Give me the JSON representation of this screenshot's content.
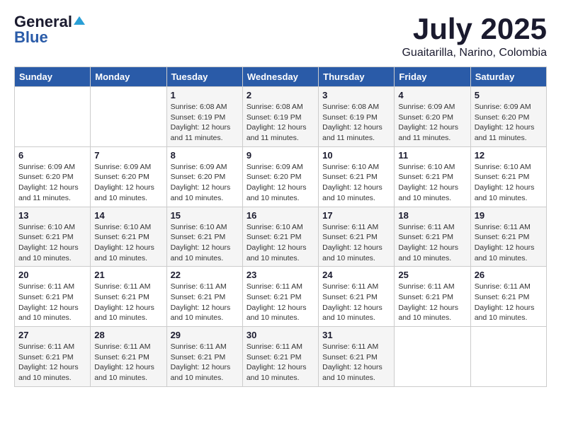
{
  "header": {
    "logo_general": "General",
    "logo_blue": "Blue",
    "month_title": "July 2025",
    "subtitle": "Guaitarilla, Narino, Colombia"
  },
  "calendar": {
    "days_of_week": [
      "Sunday",
      "Monday",
      "Tuesday",
      "Wednesday",
      "Thursday",
      "Friday",
      "Saturday"
    ],
    "weeks": [
      [
        {
          "day": "",
          "info": ""
        },
        {
          "day": "",
          "info": ""
        },
        {
          "day": "1",
          "info": "Sunrise: 6:08 AM\nSunset: 6:19 PM\nDaylight: 12 hours and 11 minutes."
        },
        {
          "day": "2",
          "info": "Sunrise: 6:08 AM\nSunset: 6:19 PM\nDaylight: 12 hours and 11 minutes."
        },
        {
          "day": "3",
          "info": "Sunrise: 6:08 AM\nSunset: 6:19 PM\nDaylight: 12 hours and 11 minutes."
        },
        {
          "day": "4",
          "info": "Sunrise: 6:09 AM\nSunset: 6:20 PM\nDaylight: 12 hours and 11 minutes."
        },
        {
          "day": "5",
          "info": "Sunrise: 6:09 AM\nSunset: 6:20 PM\nDaylight: 12 hours and 11 minutes."
        }
      ],
      [
        {
          "day": "6",
          "info": "Sunrise: 6:09 AM\nSunset: 6:20 PM\nDaylight: 12 hours and 11 minutes."
        },
        {
          "day": "7",
          "info": "Sunrise: 6:09 AM\nSunset: 6:20 PM\nDaylight: 12 hours and 10 minutes."
        },
        {
          "day": "8",
          "info": "Sunrise: 6:09 AM\nSunset: 6:20 PM\nDaylight: 12 hours and 10 minutes."
        },
        {
          "day": "9",
          "info": "Sunrise: 6:09 AM\nSunset: 6:20 PM\nDaylight: 12 hours and 10 minutes."
        },
        {
          "day": "10",
          "info": "Sunrise: 6:10 AM\nSunset: 6:21 PM\nDaylight: 12 hours and 10 minutes."
        },
        {
          "day": "11",
          "info": "Sunrise: 6:10 AM\nSunset: 6:21 PM\nDaylight: 12 hours and 10 minutes."
        },
        {
          "day": "12",
          "info": "Sunrise: 6:10 AM\nSunset: 6:21 PM\nDaylight: 12 hours and 10 minutes."
        }
      ],
      [
        {
          "day": "13",
          "info": "Sunrise: 6:10 AM\nSunset: 6:21 PM\nDaylight: 12 hours and 10 minutes."
        },
        {
          "day": "14",
          "info": "Sunrise: 6:10 AM\nSunset: 6:21 PM\nDaylight: 12 hours and 10 minutes."
        },
        {
          "day": "15",
          "info": "Sunrise: 6:10 AM\nSunset: 6:21 PM\nDaylight: 12 hours and 10 minutes."
        },
        {
          "day": "16",
          "info": "Sunrise: 6:10 AM\nSunset: 6:21 PM\nDaylight: 12 hours and 10 minutes."
        },
        {
          "day": "17",
          "info": "Sunrise: 6:11 AM\nSunset: 6:21 PM\nDaylight: 12 hours and 10 minutes."
        },
        {
          "day": "18",
          "info": "Sunrise: 6:11 AM\nSunset: 6:21 PM\nDaylight: 12 hours and 10 minutes."
        },
        {
          "day": "19",
          "info": "Sunrise: 6:11 AM\nSunset: 6:21 PM\nDaylight: 12 hours and 10 minutes."
        }
      ],
      [
        {
          "day": "20",
          "info": "Sunrise: 6:11 AM\nSunset: 6:21 PM\nDaylight: 12 hours and 10 minutes."
        },
        {
          "day": "21",
          "info": "Sunrise: 6:11 AM\nSunset: 6:21 PM\nDaylight: 12 hours and 10 minutes."
        },
        {
          "day": "22",
          "info": "Sunrise: 6:11 AM\nSunset: 6:21 PM\nDaylight: 12 hours and 10 minutes."
        },
        {
          "day": "23",
          "info": "Sunrise: 6:11 AM\nSunset: 6:21 PM\nDaylight: 12 hours and 10 minutes."
        },
        {
          "day": "24",
          "info": "Sunrise: 6:11 AM\nSunset: 6:21 PM\nDaylight: 12 hours and 10 minutes."
        },
        {
          "day": "25",
          "info": "Sunrise: 6:11 AM\nSunset: 6:21 PM\nDaylight: 12 hours and 10 minutes."
        },
        {
          "day": "26",
          "info": "Sunrise: 6:11 AM\nSunset: 6:21 PM\nDaylight: 12 hours and 10 minutes."
        }
      ],
      [
        {
          "day": "27",
          "info": "Sunrise: 6:11 AM\nSunset: 6:21 PM\nDaylight: 12 hours and 10 minutes."
        },
        {
          "day": "28",
          "info": "Sunrise: 6:11 AM\nSunset: 6:21 PM\nDaylight: 12 hours and 10 minutes."
        },
        {
          "day": "29",
          "info": "Sunrise: 6:11 AM\nSunset: 6:21 PM\nDaylight: 12 hours and 10 minutes."
        },
        {
          "day": "30",
          "info": "Sunrise: 6:11 AM\nSunset: 6:21 PM\nDaylight: 12 hours and 10 minutes."
        },
        {
          "day": "31",
          "info": "Sunrise: 6:11 AM\nSunset: 6:21 PM\nDaylight: 12 hours and 10 minutes."
        },
        {
          "day": "",
          "info": ""
        },
        {
          "day": "",
          "info": ""
        }
      ]
    ]
  }
}
